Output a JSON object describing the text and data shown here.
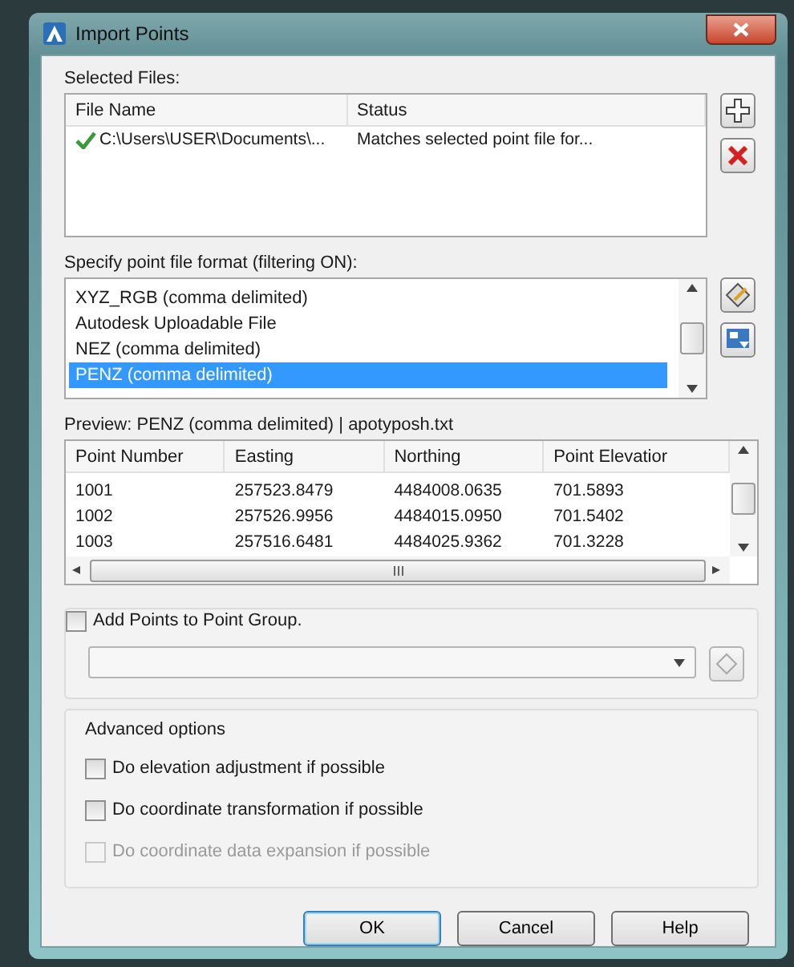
{
  "window": {
    "title": "Import Points"
  },
  "selected_files": {
    "label": "Selected Files:",
    "columns": [
      "File Name",
      "Status"
    ],
    "rows": [
      {
        "file_name": "C:\\Users\\USER\\Documents\\...",
        "status": "Matches selected point file for..."
      }
    ]
  },
  "format": {
    "label": "Specify point file format (filtering ON):",
    "items": [
      {
        "label": "XYZ_RGB (comma delimited)",
        "selected": false
      },
      {
        "label": "Autodesk Uploadable File",
        "selected": false
      },
      {
        "label": "NEZ (comma delimited)",
        "selected": false
      },
      {
        "label": "PENZ (comma delimited)",
        "selected": true
      }
    ]
  },
  "preview": {
    "label": "Preview: PENZ (comma delimited) | apotyposh.txt",
    "columns": [
      "Point Number",
      "Easting",
      "Northing",
      "Point Elevatior"
    ],
    "rows": [
      [
        "1001",
        "257523.8479",
        "4484008.0635",
        "701.5893"
      ],
      [
        "1002",
        "257526.9956",
        "4484015.0950",
        "701.5402"
      ],
      [
        "1003",
        "257516.6481",
        "4484025.9362",
        "701.3228"
      ]
    ]
  },
  "point_group": {
    "label": "Add Points to Point Group.",
    "checked": false
  },
  "advanced": {
    "label": "Advanced options",
    "options": [
      {
        "label": "Do elevation adjustment if possible",
        "checked": false,
        "disabled": false
      },
      {
        "label": "Do coordinate transformation if possible",
        "checked": false,
        "disabled": false
      },
      {
        "label": "Do coordinate data expansion if possible",
        "checked": false,
        "disabled": true
      }
    ]
  },
  "buttons": [
    {
      "label": "OK",
      "default": true
    },
    {
      "label": "Cancel",
      "default": false
    },
    {
      "label": "Help",
      "default": false
    }
  ]
}
